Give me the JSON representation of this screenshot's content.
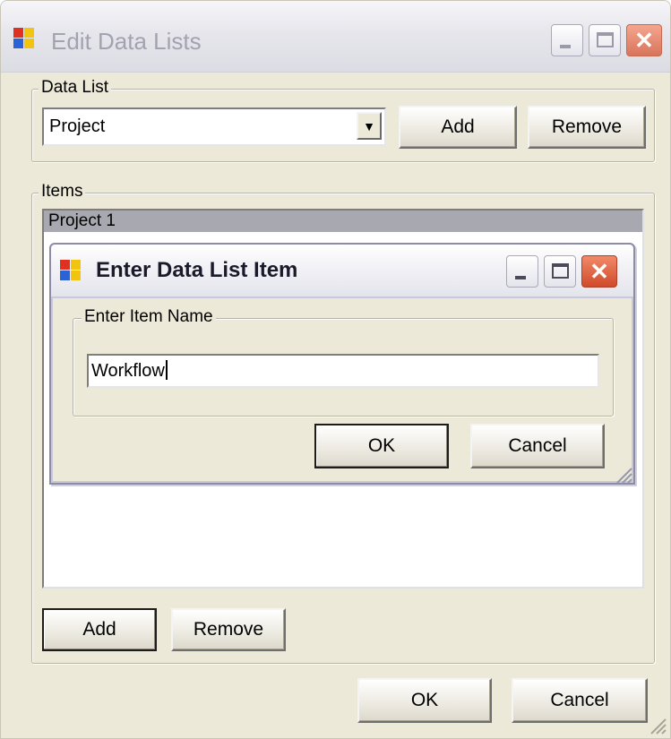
{
  "window": {
    "title": "Edit Data Lists",
    "controls": {
      "minimize_icon": "minimize-icon",
      "maximize_icon": "maximize-icon",
      "close_icon": "close-icon"
    }
  },
  "data_list_group": {
    "legend": "Data List",
    "selected_value": "Project",
    "add_label": "Add",
    "remove_label": "Remove"
  },
  "items_group": {
    "legend": "Items",
    "items": [
      "Project 1"
    ],
    "selected_index": 0,
    "add_label": "Add",
    "remove_label": "Remove"
  },
  "footer": {
    "ok_label": "OK",
    "cancel_label": "Cancel"
  },
  "dialog": {
    "title": "Enter Data List Item",
    "group_legend": "Enter Item Name",
    "input_value": "Workflow",
    "ok_label": "OK",
    "cancel_label": "Cancel"
  },
  "colors": {
    "window_bg": "#ece9d8",
    "selection": "#a8a8b0",
    "close_button": "#d8745b"
  }
}
